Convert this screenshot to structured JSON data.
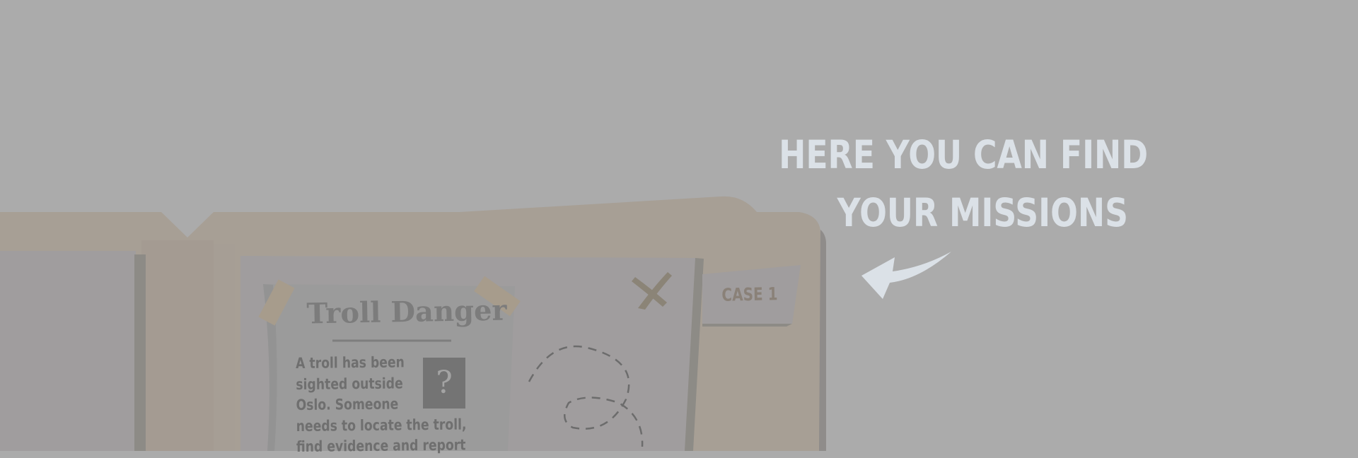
{
  "tutorial": {
    "hint_line_1": "HERE YOU CAN FIND",
    "hint_line_2": "YOUR MISSIONS"
  },
  "mission_book": {
    "case_tab": "CASE 1",
    "poster": {
      "title": "Troll Danger",
      "photo_placeholder": "?",
      "body_lines": [
        "A troll has been",
        "sighted outside",
        "Oslo.  Someone",
        "needs to locate the troll,",
        "find  evidence  and  report"
      ]
    }
  },
  "colors": {
    "overlay": "#ababab",
    "hint_text": "#dbe1e7",
    "book_cover": "#a79f95",
    "page": "#a09d9e",
    "poster": "#9c9c9c"
  }
}
